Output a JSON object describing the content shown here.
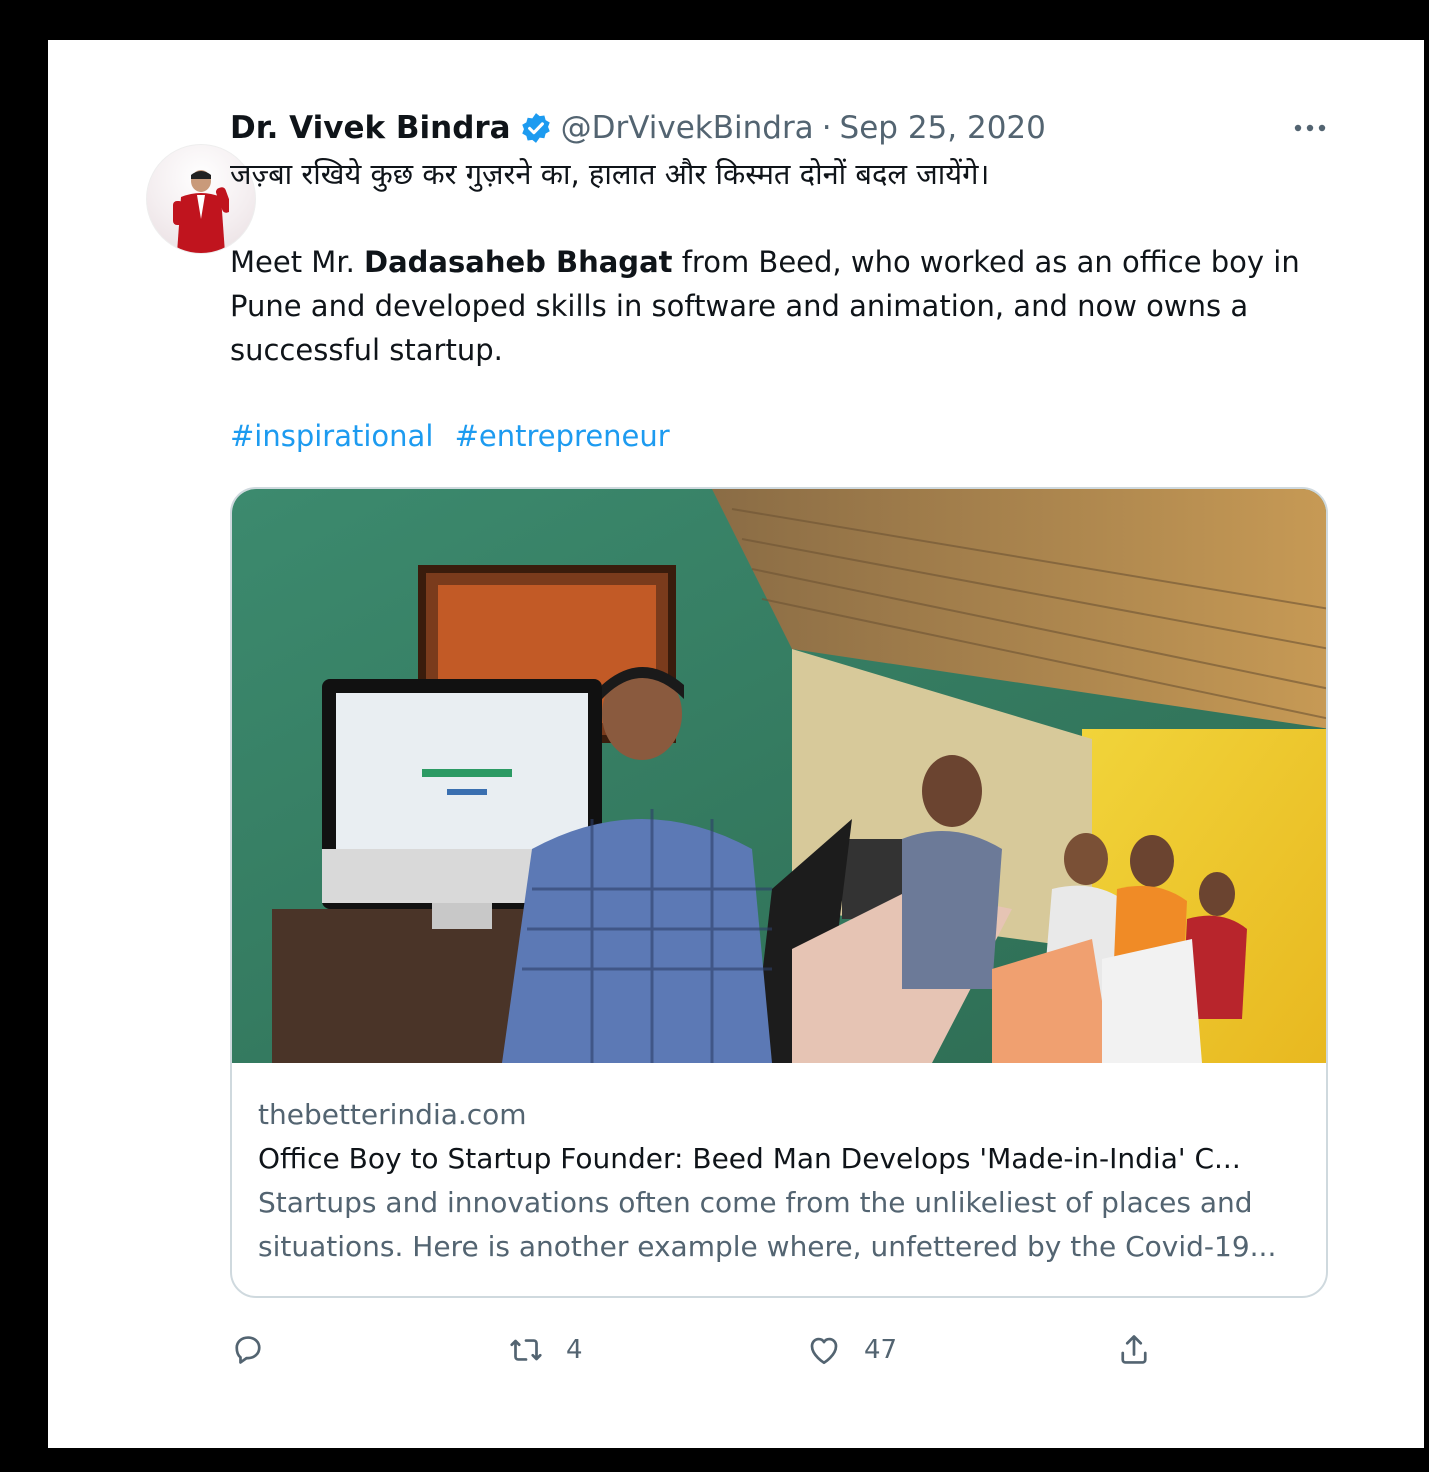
{
  "tweet": {
    "author": {
      "display_name": "Dr. Vivek Bindra",
      "handle": "@DrVivekBindra",
      "verified": true
    },
    "separator": "·",
    "date": "Sep 25, 2020",
    "text": {
      "hindi_line": "जज़्बा रखिये कुछ कर गुज़रने का, हालात और किस्मत दोनों बदल जायेंगे।",
      "para2_prefix": "Meet Mr. ",
      "para2_bold": "Dadasaheb Bhagat",
      "para2_suffix": " from Beed, who worked as an office boy in Pune and developed skills in software and animation, and now owns a successful startup.",
      "hashtags": [
        "#inspirational",
        "#entrepreneur"
      ]
    },
    "link_card": {
      "domain": "thebetterindia.com",
      "title": "Office Boy to Startup Founder: Beed Man Develops 'Made-in-India' C...",
      "description": "Startups and innovations often come from the unlikeliest of places and situations. Here is another example where, unfettered by the Covid-19..."
    },
    "actions": {
      "reply_count": "",
      "retweet_count": "4",
      "like_count": "47"
    },
    "icons": {
      "verified": "verified-badge-icon",
      "more": "more-options-icon",
      "reply": "reply-icon",
      "retweet": "retweet-icon",
      "like": "heart-icon",
      "share": "share-icon"
    },
    "colors": {
      "link": "#1d9bf0",
      "secondary_text": "#536471",
      "border": "#cfd9de"
    }
  }
}
